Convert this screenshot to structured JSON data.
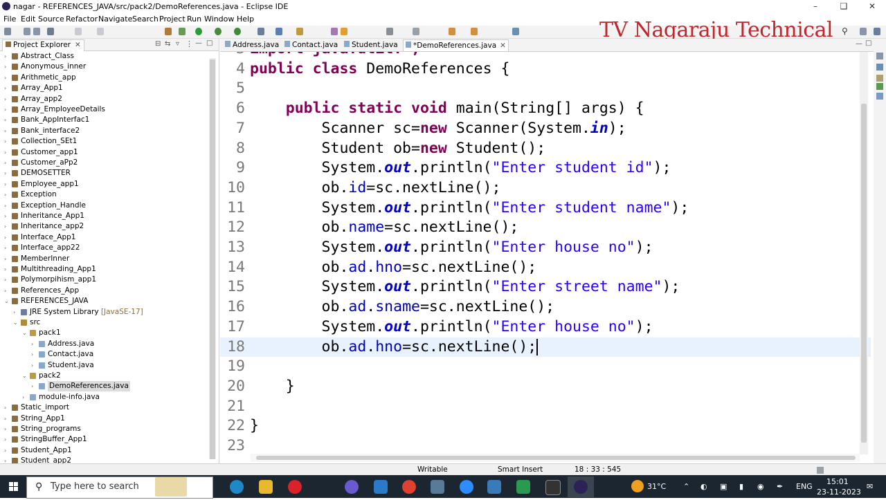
{
  "window": {
    "title": "nagar - REFERENCES_JAVA/src/pack2/DemoReferences.java - Eclipse IDE"
  },
  "menu": [
    "File",
    "Edit",
    "Source",
    "Refactor",
    "Navigate",
    "Search",
    "Project",
    "Run",
    "Window",
    "Help"
  ],
  "watermark": "TV Nagaraju Technical",
  "explorer": {
    "title": "Project Explorer",
    "items": [
      {
        "label": "Abstract_Class",
        "depth": 0,
        "kind": "project",
        "twisty": ">"
      },
      {
        "label": "Anonymous_inner",
        "depth": 0,
        "kind": "project",
        "twisty": ">"
      },
      {
        "label": "Arithmetic_app",
        "depth": 0,
        "kind": "project",
        "twisty": ">"
      },
      {
        "label": "Array_App1",
        "depth": 0,
        "kind": "project",
        "twisty": ">"
      },
      {
        "label": "Array_app2",
        "depth": 0,
        "kind": "project",
        "twisty": ">"
      },
      {
        "label": "Array_EmployeeDetails",
        "depth": 0,
        "kind": "project",
        "twisty": ">"
      },
      {
        "label": "Bank_AppInterfac1",
        "depth": 0,
        "kind": "project",
        "twisty": ">"
      },
      {
        "label": "Bank_interface2",
        "depth": 0,
        "kind": "project",
        "twisty": ">"
      },
      {
        "label": "Collection_SEt1",
        "depth": 0,
        "kind": "project",
        "twisty": ">"
      },
      {
        "label": "Customer_app1",
        "depth": 0,
        "kind": "project",
        "twisty": ">"
      },
      {
        "label": "Customer_aPp2",
        "depth": 0,
        "kind": "project",
        "twisty": ">"
      },
      {
        "label": "DEMOSETTER",
        "depth": 0,
        "kind": "project",
        "twisty": ">"
      },
      {
        "label": "Employee_app1",
        "depth": 0,
        "kind": "project",
        "twisty": ">"
      },
      {
        "label": "Exception",
        "depth": 0,
        "kind": "project",
        "twisty": ">"
      },
      {
        "label": "Exception_Handle",
        "depth": 0,
        "kind": "project",
        "twisty": ">"
      },
      {
        "label": "Inheritance_App1",
        "depth": 0,
        "kind": "project",
        "twisty": ">"
      },
      {
        "label": "Inheritance_app2",
        "depth": 0,
        "kind": "project",
        "twisty": ">"
      },
      {
        "label": "Interface_App1",
        "depth": 0,
        "kind": "project",
        "twisty": ">"
      },
      {
        "label": "Interface_app22",
        "depth": 0,
        "kind": "project",
        "twisty": ">"
      },
      {
        "label": "MemberInner",
        "depth": 0,
        "kind": "project",
        "twisty": ">"
      },
      {
        "label": "Multithreading_App1",
        "depth": 0,
        "kind": "project",
        "twisty": ">"
      },
      {
        "label": "Polymorpihism_app1",
        "depth": 0,
        "kind": "project",
        "twisty": ">"
      },
      {
        "label": "References_App",
        "depth": 0,
        "kind": "project",
        "twisty": ">"
      },
      {
        "label": "REFERENCES_JAVA",
        "depth": 0,
        "kind": "project",
        "twisty": "v"
      },
      {
        "label": "JRE System Library",
        "decoration": "[JavaSE-17]",
        "depth": 1,
        "kind": "library",
        "twisty": ">"
      },
      {
        "label": "src",
        "depth": 1,
        "kind": "folder",
        "twisty": "v"
      },
      {
        "label": "pack1",
        "depth": 2,
        "kind": "package",
        "twisty": "v"
      },
      {
        "label": "Address.java",
        "depth": 3,
        "kind": "file",
        "twisty": ">"
      },
      {
        "label": "Contact.java",
        "depth": 3,
        "kind": "file",
        "twisty": ">"
      },
      {
        "label": "Student.java",
        "depth": 3,
        "kind": "file",
        "twisty": ">"
      },
      {
        "label": "pack2",
        "depth": 2,
        "kind": "package",
        "twisty": "v"
      },
      {
        "label": "DemoReferences.java",
        "depth": 3,
        "kind": "file",
        "twisty": ">",
        "selected": true
      },
      {
        "label": "module-info.java",
        "depth": 2,
        "kind": "file",
        "twisty": ">"
      },
      {
        "label": "Static_import",
        "depth": 0,
        "kind": "project",
        "twisty": ">"
      },
      {
        "label": "String_App1",
        "depth": 0,
        "kind": "project",
        "twisty": ">"
      },
      {
        "label": "String_programs",
        "depth": 0,
        "kind": "project",
        "twisty": ">"
      },
      {
        "label": "StringBuffer_App1",
        "depth": 0,
        "kind": "project",
        "twisty": ">"
      },
      {
        "label": "Student_App1",
        "depth": 0,
        "kind": "project",
        "twisty": ">"
      },
      {
        "label": "Student_app2",
        "depth": 0,
        "kind": "project",
        "twisty": ">"
      }
    ]
  },
  "editor": {
    "tabs": [
      {
        "label": "Address.java",
        "active": false
      },
      {
        "label": "Contact.java",
        "active": false
      },
      {
        "label": "Student.java",
        "active": false
      },
      {
        "label": "*DemoReferences.java",
        "active": true
      }
    ],
    "lines": [
      {
        "n": "3",
        "tokens": [
          {
            "t": "import java.util.*;",
            "c": "kw"
          }
        ],
        "partial": true
      },
      {
        "n": "4",
        "tokens": [
          {
            "t": "public",
            "c": "kw"
          },
          {
            "t": " "
          },
          {
            "t": "class",
            "c": "kw"
          },
          {
            "t": " DemoReferences {"
          }
        ]
      },
      {
        "n": "5",
        "tokens": []
      },
      {
        "n": "6",
        "tokens": [
          {
            "t": "    "
          },
          {
            "t": "public",
            "c": "kw"
          },
          {
            "t": " "
          },
          {
            "t": "static",
            "c": "kw"
          },
          {
            "t": " "
          },
          {
            "t": "void",
            "c": "kw"
          },
          {
            "t": " main(String[] args) {"
          }
        ]
      },
      {
        "n": "7",
        "tokens": [
          {
            "t": "        Scanner sc="
          },
          {
            "t": "new",
            "c": "kw"
          },
          {
            "t": " Scanner(System."
          },
          {
            "t": "in",
            "c": "sfld"
          },
          {
            "t": ");"
          }
        ]
      },
      {
        "n": "8",
        "tokens": [
          {
            "t": "        Student ob="
          },
          {
            "t": "new",
            "c": "kw"
          },
          {
            "t": " Student();"
          }
        ]
      },
      {
        "n": "9",
        "tokens": [
          {
            "t": "        System."
          },
          {
            "t": "out",
            "c": "sfld"
          },
          {
            "t": ".println("
          },
          {
            "t": "\"Enter student id\"",
            "c": "str"
          },
          {
            "t": ");"
          }
        ]
      },
      {
        "n": "10",
        "tokens": [
          {
            "t": "        ob."
          },
          {
            "t": "id",
            "c": "fld"
          },
          {
            "t": "=sc.nextLine();"
          }
        ]
      },
      {
        "n": "11",
        "tokens": [
          {
            "t": "        System."
          },
          {
            "t": "out",
            "c": "sfld"
          },
          {
            "t": ".println("
          },
          {
            "t": "\"Enter student name\"",
            "c": "str"
          },
          {
            "t": ");"
          }
        ]
      },
      {
        "n": "12",
        "tokens": [
          {
            "t": "        ob."
          },
          {
            "t": "name",
            "c": "fld"
          },
          {
            "t": "=sc.nextLine();"
          }
        ]
      },
      {
        "n": "13",
        "tokens": [
          {
            "t": "        System."
          },
          {
            "t": "out",
            "c": "sfld"
          },
          {
            "t": ".println("
          },
          {
            "t": "\"Enter house no\"",
            "c": "str"
          },
          {
            "t": ");"
          }
        ]
      },
      {
        "n": "14",
        "tokens": [
          {
            "t": "        ob."
          },
          {
            "t": "ad",
            "c": "fld"
          },
          {
            "t": "."
          },
          {
            "t": "hno",
            "c": "fld"
          },
          {
            "t": "=sc.nextLine();"
          }
        ]
      },
      {
        "n": "15",
        "tokens": [
          {
            "t": "        System."
          },
          {
            "t": "out",
            "c": "sfld"
          },
          {
            "t": ".println("
          },
          {
            "t": "\"Enter street name\"",
            "c": "str"
          },
          {
            "t": ");"
          }
        ]
      },
      {
        "n": "16",
        "tokens": [
          {
            "t": "        ob."
          },
          {
            "t": "ad",
            "c": "fld"
          },
          {
            "t": "."
          },
          {
            "t": "sname",
            "c": "fld"
          },
          {
            "t": "=sc.nextLine();"
          }
        ]
      },
      {
        "n": "17",
        "tokens": [
          {
            "t": "        System."
          },
          {
            "t": "out",
            "c": "sfld"
          },
          {
            "t": ".println("
          },
          {
            "t": "\"Enter house no\"",
            "c": "str"
          },
          {
            "t": ");"
          }
        ]
      },
      {
        "n": "18",
        "tokens": [
          {
            "t": "        ob."
          },
          {
            "t": "ad",
            "c": "fld"
          },
          {
            "t": "."
          },
          {
            "t": "hno",
            "c": "fld"
          },
          {
            "t": "=sc.nextLine();"
          }
        ],
        "current": true
      },
      {
        "n": "19",
        "tokens": []
      },
      {
        "n": "20",
        "tokens": [
          {
            "t": "    }"
          }
        ]
      },
      {
        "n": "21",
        "tokens": []
      },
      {
        "n": "22",
        "tokens": [
          {
            "t": "}"
          }
        ]
      },
      {
        "n": "23",
        "tokens": []
      }
    ]
  },
  "status": {
    "writable": "Writable",
    "insert_mode": "Smart Insert",
    "position": "18 : 33 : 545"
  },
  "taskbar": {
    "search_placeholder": "Type here to search",
    "weather": "31°C",
    "language": "ENG",
    "time": "15:01",
    "date": "23-11-2023"
  },
  "colors": {
    "keyword": "#7f0055",
    "string": "#2a00ff",
    "field": "#0000c0",
    "watermark": "#c0262c",
    "taskbar": "#1c2630"
  }
}
